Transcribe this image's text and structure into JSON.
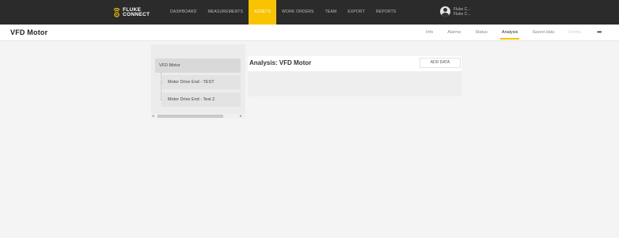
{
  "brand": {
    "logo_text_line1": "FLUKE",
    "logo_text_line2": "CONNECT",
    "logo_icon": "fluke-wifi-icon",
    "accent_color": "#f9c300"
  },
  "nav": {
    "items": [
      {
        "label": "DASHBOARD"
      },
      {
        "label": "MEASUREMENTS"
      },
      {
        "label": "ASSETS",
        "active": true
      },
      {
        "label": "WORK ORDERS"
      },
      {
        "label": "TEAM"
      },
      {
        "label": "EXPORT"
      },
      {
        "label": "REPORTS"
      }
    ]
  },
  "user": {
    "line1": "Fluke C...",
    "line2": "Fluke C...",
    "icon": "user-avatar-icon"
  },
  "header": {
    "title": "VFD Motor",
    "tabs": [
      {
        "label": "Info"
      },
      {
        "label": "Alarms"
      },
      {
        "label": "Status"
      },
      {
        "label": "Analysis",
        "active": true
      },
      {
        "label": "Saved data"
      },
      {
        "label": "Forms",
        "disabled": true
      }
    ],
    "more_icon": "more-horizontal-icon",
    "more_label": "•••"
  },
  "tree": {
    "root": "VFD Motor",
    "children": [
      "Motor Drive End - TEST",
      "Motor Drive End - Test 2"
    ],
    "scroll_left": "◂",
    "scroll_right": "▸"
  },
  "analysis": {
    "title": "Analysis: VFD Motor",
    "add_button": "ADD DATA"
  }
}
